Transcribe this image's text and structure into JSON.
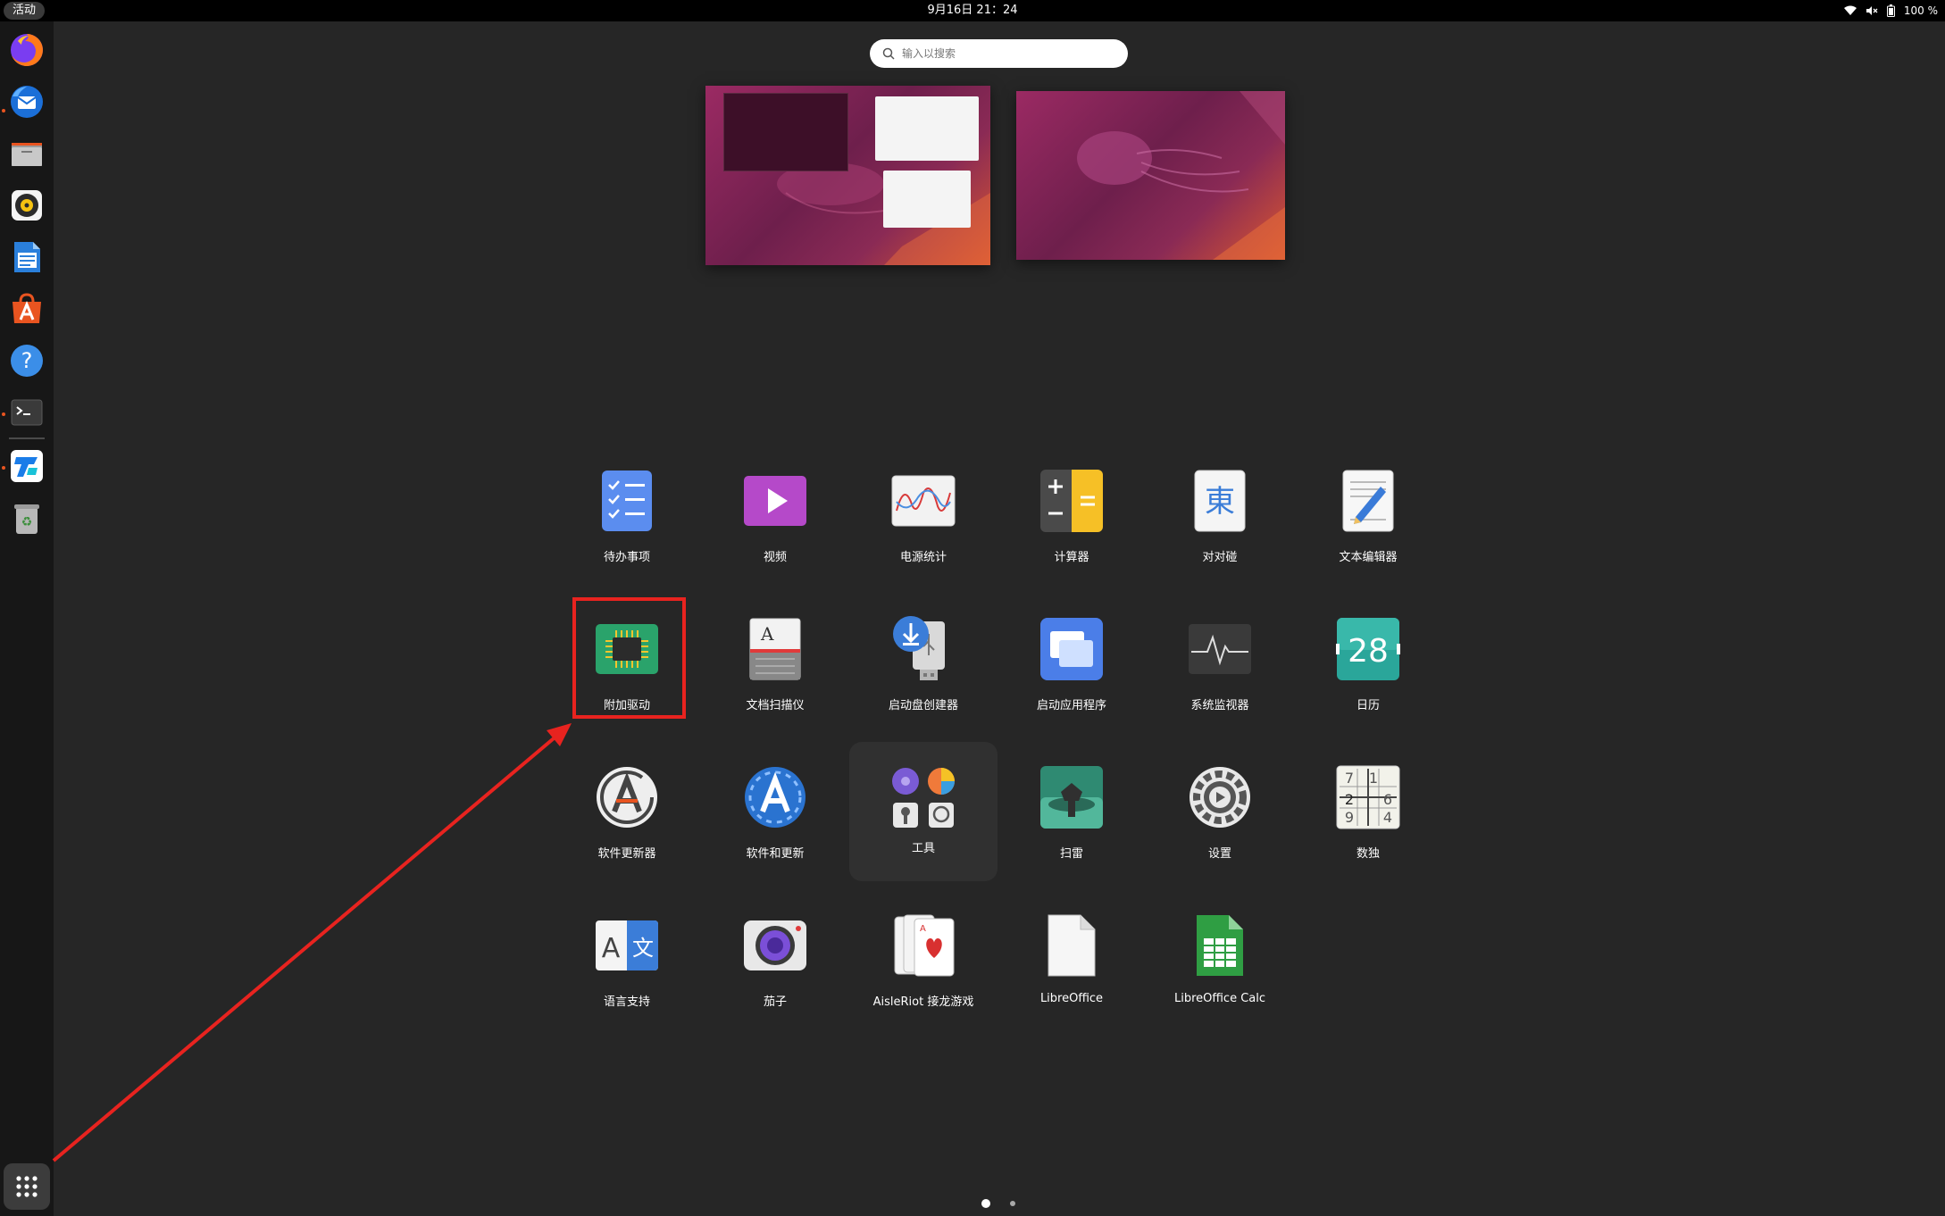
{
  "topbar": {
    "activities": "活动",
    "clock": "9月16日  21：24",
    "battery": "100 %",
    "icons": [
      "wifi-icon",
      "volume-icon",
      "battery-icon"
    ]
  },
  "dock": {
    "items": [
      {
        "name": "firefox",
        "icon": "firefox-icon",
        "running": false
      },
      {
        "name": "thunderbird",
        "icon": "thunderbird-icon",
        "running": false
      },
      {
        "name": "files",
        "icon": "files-icon",
        "running": true
      },
      {
        "name": "rhythmbox",
        "icon": "rhythmbox-icon",
        "running": false
      },
      {
        "name": "libreoffice-writer",
        "icon": "writer-icon",
        "running": false
      },
      {
        "name": "ubuntu-software",
        "icon": "software-icon",
        "running": false
      },
      {
        "name": "help",
        "icon": "help-icon",
        "running": false
      },
      {
        "name": "terminal",
        "icon": "terminal-icon",
        "running": true
      },
      {
        "name": "todesk",
        "icon": "remote-desktop-icon",
        "running": true
      },
      {
        "name": "trash",
        "icon": "trash-icon",
        "running": false
      }
    ],
    "show_apps_icon": "grid-icon"
  },
  "search": {
    "placeholder": "输入以搜索"
  },
  "apps": [
    {
      "label": "待办事项",
      "icon": "todo-icon"
    },
    {
      "label": "视频",
      "icon": "video-icon"
    },
    {
      "label": "电源统计",
      "icon": "power-statistics-icon"
    },
    {
      "label": "计算器",
      "icon": "calculator-icon"
    },
    {
      "label": "对对碰",
      "icon": "mahjongg-icon"
    },
    {
      "label": "文本编辑器",
      "icon": "text-editor-icon"
    },
    {
      "label": "附加驱动",
      "icon": "chip-icon"
    },
    {
      "label": "文档扫描仪",
      "icon": "scanner-icon"
    },
    {
      "label": "启动盘创建器",
      "icon": "usb-creator-icon"
    },
    {
      "label": "启动应用程序",
      "icon": "startup-apps-icon"
    },
    {
      "label": "系统监视器",
      "icon": "system-monitor-icon"
    },
    {
      "label": "日历",
      "icon": "calendar-icon",
      "badge": "28"
    },
    {
      "label": "软件更新器",
      "icon": "software-updater-icon"
    },
    {
      "label": "软件和更新",
      "icon": "software-updates-icon"
    },
    {
      "label": "工具",
      "icon": "folder-icon"
    },
    {
      "label": "扫雷",
      "icon": "mines-icon"
    },
    {
      "label": "设置",
      "icon": "settings-icon"
    },
    {
      "label": "数独",
      "icon": "sudoku-icon"
    },
    {
      "label": "语言支持",
      "icon": "language-icon"
    },
    {
      "label": "茄子",
      "icon": "cheese-icon"
    },
    {
      "label": "AisleRiot 接龙游戏",
      "icon": "cards-icon"
    },
    {
      "label": "LibreOffice",
      "icon": "libreoffice-icon"
    },
    {
      "label": "LibreOffice Calc",
      "icon": "calc-icon"
    }
  ],
  "sudoku_digits": [
    "7",
    "1",
    "2",
    "6",
    "9",
    "4"
  ],
  "highlighted_app": "附加驱动",
  "page_indicator": {
    "pages": 2,
    "current": 1
  },
  "colors": {
    "accent": "#e95420",
    "highlight": "#e8231f",
    "background": "#262626"
  }
}
